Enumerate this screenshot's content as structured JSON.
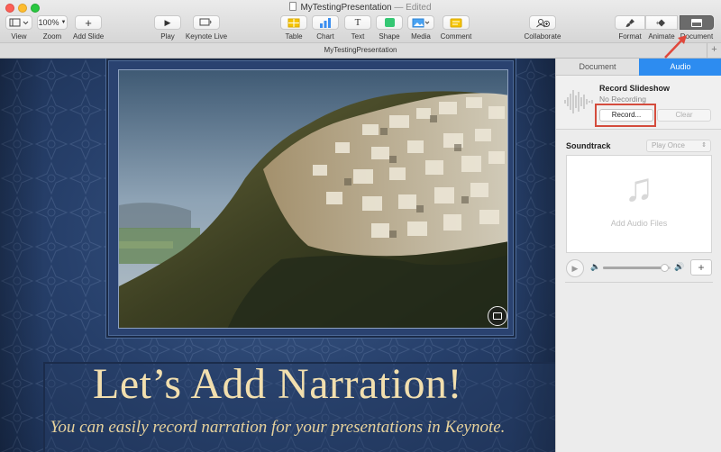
{
  "window": {
    "title": "MyTestingPresentation",
    "edited": "— Edited"
  },
  "toolbar": {
    "view": {
      "label": "View"
    },
    "zoom": {
      "label": "Zoom",
      "value": "100%"
    },
    "add_slide": {
      "label": "Add Slide"
    },
    "play": {
      "label": "Play"
    },
    "keynote_live": {
      "label": "Keynote Live"
    },
    "table": {
      "label": "Table"
    },
    "chart": {
      "label": "Chart"
    },
    "text": {
      "label": "Text"
    },
    "shape": {
      "label": "Shape"
    },
    "media": {
      "label": "Media"
    },
    "comment": {
      "label": "Comment"
    },
    "collaborate": {
      "label": "Collaborate"
    },
    "format": {
      "label": "Format"
    },
    "animate": {
      "label": "Animate"
    },
    "document": {
      "label": "Document"
    }
  },
  "tab": {
    "title": "MyTestingPresentation"
  },
  "slide": {
    "title": "Let’s Add Narration!",
    "subtitle": "You can easily record narration for your presentations in Keynote."
  },
  "inspector": {
    "tabs": {
      "document": "Document",
      "audio": "Audio"
    },
    "record": {
      "title": "Record Slideshow",
      "status": "No Recording",
      "record_button": "Record...",
      "clear_button": "Clear"
    },
    "soundtrack": {
      "label": "Soundtrack",
      "mode": "Play Once",
      "drop_label": "Add Audio Files",
      "volume_level": 0.9
    }
  },
  "colors": {
    "accent": "#2d8cf0",
    "highlight": "#d44c3d",
    "slide_title": "#f2dfae",
    "slide_bg": "#2b4573"
  }
}
